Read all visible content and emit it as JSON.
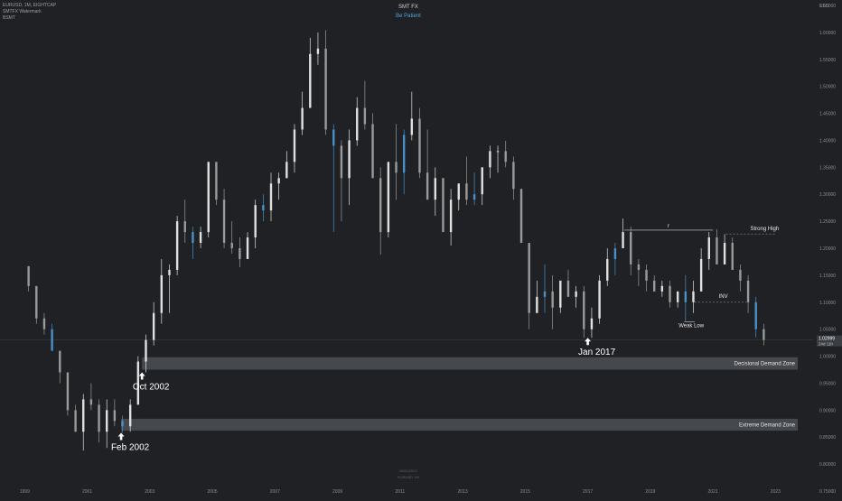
{
  "header": {
    "symbol_line": "EURUSD, 1M, EIGHTCAP",
    "indicator1": "SMTFX Watermark",
    "indicator2": "BSMT"
  },
  "title": {
    "main": "SMT FX",
    "subtitle": "Be Patient"
  },
  "watermark": {
    "line1": "06/11/2022",
    "line2": "EURUSD 1M"
  },
  "colors": {
    "background": "#1f2124",
    "candle_up": "#e0e0e0",
    "candle_down": "#9a9a9a",
    "candle_accent": "#4a90c8",
    "zone": "#45484d",
    "axis_text": "#8a8f98",
    "subtitle": "#4fa3e0",
    "price_tag": "#3a3d42"
  },
  "chart_data": {
    "type": "candlestick",
    "timeframe": "1M",
    "currency": "USD",
    "x_ticks": [
      "1999",
      "2001",
      "2003",
      "2005",
      "2007",
      "2009",
      "2011",
      "2013",
      "2015",
      "2017",
      "2019",
      "2021",
      "2023"
    ],
    "y_ticks": [
      "1.65000",
      "1.60000",
      "1.55000",
      "1.50000",
      "1.45000",
      "1.40000",
      "1.35000",
      "1.30000",
      "1.25000",
      "1.20000",
      "1.15000",
      "1.10000",
      "1.05000",
      "1.00000",
      "0.95000",
      "0.90000",
      "0.85000",
      "0.80000",
      "0.75000"
    ],
    "ylim": [
      0.74,
      1.66
    ],
    "current_price": {
      "value": 1.0299,
      "label": "1.02999",
      "countdown": "24d 11h"
    },
    "zones": [
      {
        "label": "Decisional Demand Zone",
        "start": "2002-10",
        "low": 0.975,
        "high": 0.998
      },
      {
        "label": "Extreme Demand Zone",
        "start": "2002-02",
        "low": 0.862,
        "high": 0.884
      }
    ],
    "annotations": [
      {
        "text": "Oct 2002",
        "date": "2002-10",
        "price": 0.97,
        "arrow": "up"
      },
      {
        "text": "Feb 2002",
        "date": "2002-02",
        "price": 0.858,
        "arrow": "up"
      },
      {
        "text": "Jan 2017",
        "date": "2017-01",
        "price": 1.034,
        "arrow": "up"
      }
    ],
    "levels": [
      {
        "text": "Strong High",
        "from": "2021-06",
        "to": "2023-01",
        "price": 1.2265,
        "style": "dashed"
      },
      {
        "text": "INV",
        "from": "2020-06",
        "to": "2022-02",
        "price": 1.1,
        "style": "dashed"
      },
      {
        "text": "Weak Low",
        "from": "2020-02",
        "to": "2020-06",
        "price": 1.064,
        "style": "solid"
      },
      {
        "text": "r",
        "from": "2018-03",
        "to": "2021-01",
        "price": 1.2335,
        "style": "solid"
      }
    ],
    "candles": [
      [
        "1999-01",
        1.1667,
        1.1667,
        1.12,
        1.13
      ],
      [
        "1999-04",
        1.13,
        1.08,
        1.06,
        1.07
      ],
      [
        "1999-07",
        1.07,
        1.08,
        1.04,
        1.05
      ],
      [
        "1999-10",
        1.05,
        1.06,
        1.01,
        1.01
      ],
      [
        "2000-01",
        1.01,
        1.0,
        0.95,
        0.97
      ],
      [
        "2000-04",
        0.97,
        0.94,
        0.89,
        0.9
      ],
      [
        "2000-07",
        0.9,
        0.91,
        0.86,
        0.86
      ],
      [
        "2000-10",
        0.86,
        0.93,
        0.825,
        0.92
      ],
      [
        "2001-01",
        0.92,
        0.95,
        0.9,
        0.91
      ],
      [
        "2001-04",
        0.91,
        0.92,
        0.84,
        0.86
      ],
      [
        "2001-07",
        0.86,
        0.92,
        0.83,
        0.9
      ],
      [
        "2001-10",
        0.9,
        0.92,
        0.87,
        0.88
      ],
      [
        "2002-01",
        0.88,
        0.89,
        0.858,
        0.87
      ],
      [
        "2002-04",
        0.87,
        0.92,
        0.86,
        0.91
      ],
      [
        "2002-07",
        0.91,
        1.0,
        0.97,
        0.99
      ],
      [
        "2002-10",
        0.99,
        1.04,
        0.97,
        1.03
      ],
      [
        "2003-01",
        1.03,
        1.1,
        1.02,
        1.08
      ],
      [
        "2003-04",
        1.08,
        1.18,
        1.06,
        1.15
      ],
      [
        "2003-07",
        1.15,
        1.17,
        1.08,
        1.16
      ],
      [
        "2003-10",
        1.16,
        1.26,
        1.15,
        1.25
      ],
      [
        "2004-01",
        1.25,
        1.29,
        1.21,
        1.23
      ],
      [
        "2004-04",
        1.23,
        1.24,
        1.18,
        1.21
      ],
      [
        "2004-07",
        1.21,
        1.24,
        1.2,
        1.23
      ],
      [
        "2004-10",
        1.23,
        1.36,
        1.22,
        1.36
      ],
      [
        "2005-01",
        1.36,
        1.35,
        1.28,
        1.29
      ],
      [
        "2005-04",
        1.29,
        1.31,
        1.2,
        1.21
      ],
      [
        "2005-07",
        1.21,
        1.25,
        1.19,
        1.2
      ],
      [
        "2005-10",
        1.2,
        1.22,
        1.165,
        1.18
      ],
      [
        "2006-01",
        1.18,
        1.23,
        1.18,
        1.22
      ],
      [
        "2006-04",
        1.22,
        1.29,
        1.2,
        1.28
      ],
      [
        "2006-07",
        1.28,
        1.3,
        1.25,
        1.27
      ],
      [
        "2006-10",
        1.27,
        1.34,
        1.25,
        1.32
      ],
      [
        "2007-01",
        1.32,
        1.34,
        1.29,
        1.33
      ],
      [
        "2007-04",
        1.33,
        1.38,
        1.33,
        1.36
      ],
      [
        "2007-07",
        1.36,
        1.43,
        1.34,
        1.42
      ],
      [
        "2007-10",
        1.42,
        1.49,
        1.41,
        1.46
      ],
      [
        "2008-01",
        1.46,
        1.59,
        1.46,
        1.56
      ],
      [
        "2008-04",
        1.56,
        1.6,
        1.54,
        1.57
      ],
      [
        "2008-07",
        1.57,
        1.604,
        1.41,
        1.42
      ],
      [
        "2008-10",
        1.42,
        1.43,
        1.23,
        1.39
      ],
      [
        "2009-01",
        1.39,
        1.4,
        1.25,
        1.33
      ],
      [
        "2009-04",
        1.33,
        1.42,
        1.28,
        1.4
      ],
      [
        "2009-07",
        1.4,
        1.48,
        1.39,
        1.46
      ],
      [
        "2009-10",
        1.46,
        1.51,
        1.42,
        1.43
      ],
      [
        "2010-01",
        1.43,
        1.45,
        1.33,
        1.33
      ],
      [
        "2010-04",
        1.33,
        1.35,
        1.188,
        1.23
      ],
      [
        "2010-07",
        1.23,
        1.36,
        1.22,
        1.36
      ],
      [
        "2010-10",
        1.36,
        1.43,
        1.29,
        1.34
      ],
      [
        "2011-01",
        1.34,
        1.42,
        1.3,
        1.41
      ],
      [
        "2011-04",
        1.41,
        1.49,
        1.4,
        1.44
      ],
      [
        "2011-07",
        1.44,
        1.46,
        1.33,
        1.34
      ],
      [
        "2011-10",
        1.34,
        1.42,
        1.29,
        1.29
      ],
      [
        "2012-01",
        1.29,
        1.35,
        1.26,
        1.33
      ],
      [
        "2012-04",
        1.33,
        1.33,
        1.23,
        1.23
      ],
      [
        "2012-07",
        1.23,
        1.31,
        1.205,
        1.29
      ],
      [
        "2012-10",
        1.29,
        1.32,
        1.27,
        1.32
      ],
      [
        "2013-01",
        1.32,
        1.37,
        1.28,
        1.29
      ],
      [
        "2013-04",
        1.29,
        1.34,
        1.28,
        1.3
      ],
      [
        "2013-07",
        1.3,
        1.35,
        1.28,
        1.35
      ],
      [
        "2013-10",
        1.35,
        1.39,
        1.33,
        1.38
      ],
      [
        "2014-01",
        1.38,
        1.39,
        1.34,
        1.38
      ],
      [
        "2014-04",
        1.38,
        1.399,
        1.35,
        1.36
      ],
      [
        "2014-07",
        1.36,
        1.37,
        1.29,
        1.31
      ],
      [
        "2014-10",
        1.31,
        1.28,
        1.21,
        1.21
      ],
      [
        "2015-01",
        1.21,
        1.21,
        1.05,
        1.08
      ],
      [
        "2015-04",
        1.08,
        1.14,
        1.08,
        1.11
      ],
      [
        "2015-07",
        1.11,
        1.17,
        1.08,
        1.12
      ],
      [
        "2015-10",
        1.12,
        1.15,
        1.05,
        1.09
      ],
      [
        "2016-01",
        1.09,
        1.14,
        1.08,
        1.14
      ],
      [
        "2016-04",
        1.14,
        1.16,
        1.11,
        1.11
      ],
      [
        "2016-07",
        1.11,
        1.13,
        1.09,
        1.12
      ],
      [
        "2016-10",
        1.12,
        1.13,
        1.034,
        1.05
      ],
      [
        "2017-01",
        1.05,
        1.09,
        1.034,
        1.07
      ],
      [
        "2017-04",
        1.07,
        1.15,
        1.06,
        1.14
      ],
      [
        "2017-07",
        1.14,
        1.2,
        1.13,
        1.18
      ],
      [
        "2017-10",
        1.18,
        1.21,
        1.15,
        1.2
      ],
      [
        "2018-01",
        1.2,
        1.255,
        1.21,
        1.23
      ],
      [
        "2018-04",
        1.23,
        1.24,
        1.15,
        1.17
      ],
      [
        "2018-07",
        1.17,
        1.18,
        1.13,
        1.16
      ],
      [
        "2018-10",
        1.16,
        1.17,
        1.12,
        1.14
      ],
      [
        "2019-01",
        1.14,
        1.15,
        1.12,
        1.12
      ],
      [
        "2019-04",
        1.12,
        1.14,
        1.11,
        1.13
      ],
      [
        "2019-07",
        1.13,
        1.14,
        1.09,
        1.1
      ],
      [
        "2019-10",
        1.1,
        1.12,
        1.09,
        1.12
      ],
      [
        "2020-01",
        1.12,
        1.15,
        1.064,
        1.1
      ],
      [
        "2020-04",
        1.1,
        1.14,
        1.08,
        1.12
      ],
      [
        "2020-07",
        1.12,
        1.2,
        1.12,
        1.18
      ],
      [
        "2020-10",
        1.18,
        1.23,
        1.16,
        1.22
      ],
      [
        "2021-01",
        1.22,
        1.235,
        1.17,
        1.17
      ],
      [
        "2021-04",
        1.17,
        1.226,
        1.17,
        1.21
      ],
      [
        "2021-07",
        1.21,
        1.22,
        1.16,
        1.16
      ],
      [
        "2021-10",
        1.16,
        1.17,
        1.12,
        1.14
      ],
      [
        "2022-01",
        1.14,
        1.15,
        1.08,
        1.1
      ],
      [
        "2022-04",
        1.1,
        1.11,
        1.035,
        1.05
      ],
      [
        "2022-07",
        1.05,
        1.06,
        1.02,
        1.03
      ]
    ]
  }
}
